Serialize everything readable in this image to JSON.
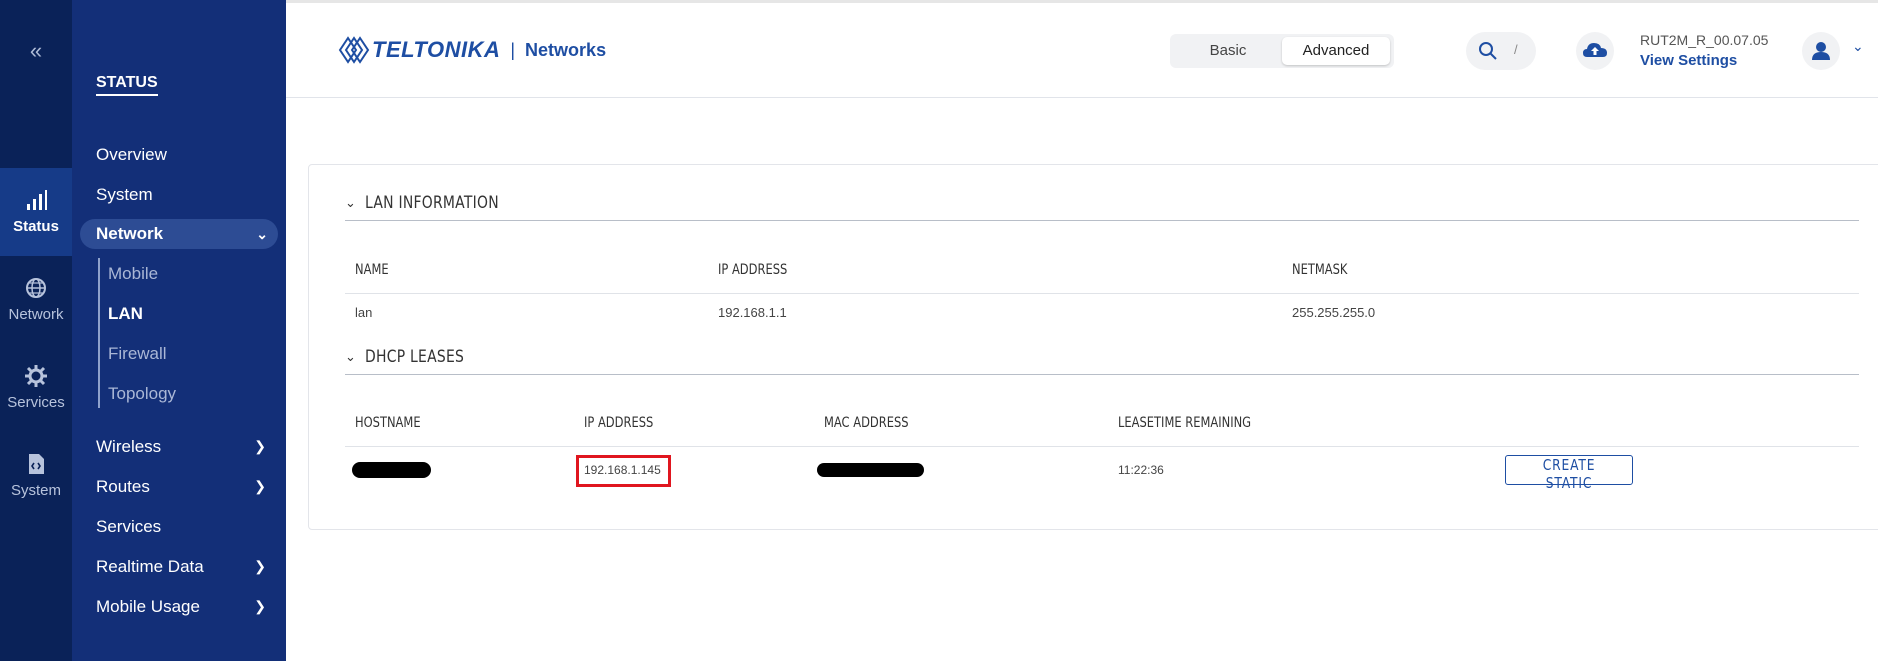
{
  "rail": {
    "collapse_glyph": "«",
    "items": [
      {
        "label": "Status",
        "icon": "signal-bars-icon"
      },
      {
        "label": "Network",
        "icon": "globe-icon"
      },
      {
        "label": "Services",
        "icon": "gear-icon"
      },
      {
        "label": "System",
        "icon": "code-file-icon"
      }
    ]
  },
  "nav": {
    "title": "STATUS",
    "items": {
      "overview": "Overview",
      "system": "System",
      "network": "Network",
      "mobile": "Mobile",
      "lan": "LAN",
      "firewall": "Firewall",
      "topology": "Topology",
      "wireless": "Wireless",
      "routes": "Routes",
      "services": "Services",
      "realtime": "Realtime Data",
      "mobile_usage": "Mobile Usage"
    }
  },
  "header": {
    "brand": "TELTONIKA",
    "separator": "|",
    "brand_suffix": "Networks",
    "mode_basic": "Basic",
    "mode_advanced": "Advanced",
    "search_shortcut": "/",
    "firmware": "RUT2M_R_00.07.05",
    "view_settings": "View Settings"
  },
  "lan_info": {
    "heading": "LAN INFORMATION",
    "columns": [
      "NAME",
      "IP ADDRESS",
      "NETMASK"
    ],
    "rows": [
      {
        "name": "lan",
        "ip": "192.168.1.1",
        "netmask": "255.255.255.0"
      }
    ]
  },
  "dhcp": {
    "heading": "DHCP LEASES",
    "columns": [
      "HOSTNAME",
      "IP ADDRESS",
      "MAC ADDRESS",
      "LEASETIME REMAINING"
    ],
    "rows": [
      {
        "hostname": "",
        "ip": "192.168.1.145",
        "mac": "",
        "leasetime": "11:22:36",
        "action": "CREATE STATIC"
      }
    ]
  },
  "colors": {
    "rail_bg": "#0a2258",
    "nav_bg": "#132f78",
    "accent": "#1e4ea3",
    "highlight_box": "#e0161f"
  }
}
